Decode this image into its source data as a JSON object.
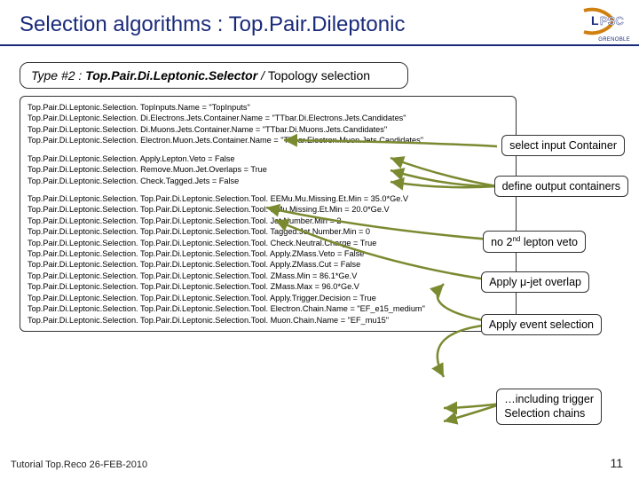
{
  "logo": {
    "text": "GRENOBLE",
    "title_big": "PSC",
    "title_l": "L"
  },
  "title": "Selection algorithms : Top.Pair.Dileptonic",
  "type_box": {
    "prefix": "Type #2 : ",
    "selector": "Top.Pair.Di.Leptonic.Selector",
    "slash": " / ",
    "suffix": "Topology selection"
  },
  "config": {
    "block1": [
      "Top.Pair.Di.Leptonic.Selection. TopInputs.Name                        = \"TopInputs\"",
      "Top.Pair.Di.Leptonic.Selection. Di.Electrons.Jets.Container.Name  = \"TTbar.Di.Electrons.Jets.Candidates\"",
      "Top.Pair.Di.Leptonic.Selection. Di.Muons.Jets.Container.Name                           = \"TTbar.Di.Muons.Jets.Candidates\"",
      "Top.Pair.Di.Leptonic.Selection. Electron.Muon.Jets.Container.Name = \"TTbar.Electron.Muon.Jets.Candidates\""
    ],
    "block2": [
      "Top.Pair.Di.Leptonic.Selection. Apply.Lepton.Veto        = False",
      "Top.Pair.Di.Leptonic.Selection. Remove.Muon.Jet.Overlaps = True",
      "Top.Pair.Di.Leptonic.Selection. Check.Tagged.Jets         = False"
    ],
    "block3": [
      "Top.Pair.Di.Leptonic.Selection. Top.Pair.Di.Leptonic.Selection.Tool. EEMu.Mu.Missing.Et.Min  = 35.0*Ge.V",
      "Top.Pair.Di.Leptonic.Selection. Top.Pair.Di.Leptonic.Selection.Tool. EMu.Missing.Et.Min    = 20.0*Ge.V",
      "Top.Pair.Di.Leptonic.Selection. Top.Pair.Di.Leptonic.Selection.Tool. Jet.Number.Min                = 2",
      "Top.Pair.Di.Leptonic.Selection. Top.Pair.Di.Leptonic.Selection.Tool. Tagged.Jet.Number.Min   = 0",
      "Top.Pair.Di.Leptonic.Selection. Top.Pair.Di.Leptonic.Selection.Tool. Check.Neutral.Charge      = True",
      "Top.Pair.Di.Leptonic.Selection. Top.Pair.Di.Leptonic.Selection.Tool. Apply.ZMass.Veto           = False",
      "Top.Pair.Di.Leptonic.Selection. Top.Pair.Di.Leptonic.Selection.Tool. Apply.ZMass.Cut             = False",
      "Top.Pair.Di.Leptonic.Selection. Top.Pair.Di.Leptonic.Selection.Tool. ZMass.Min                     = 86.1*Ge.V",
      "Top.Pair.Di.Leptonic.Selection. Top.Pair.Di.Leptonic.Selection.Tool. ZMass.Max                     = 96.0*Ge.V",
      "Top.Pair.Di.Leptonic.Selection. Top.Pair.Di.Leptonic.Selection.Tool. Apply.Trigger.Decision = True",
      "Top.Pair.Di.Leptonic.Selection. Top.Pair.Di.Leptonic.Selection.Tool. Electron.Chain.Name     = \"EF_e15_medium\"",
      "Top.Pair.Di.Leptonic.Selection. Top.Pair.Di.Leptonic.Selection.Tool. Muon.Chain.Name          = \"EF_mu15\""
    ]
  },
  "annotations": {
    "a1": "select input Container",
    "a2": "define output containers",
    "a3_left": "no 2",
    "a3_sup": "nd",
    "a3_right": " lepton veto",
    "a4_pre": "Apply ",
    "a4_mu": "μ",
    "a4_post": "-jet overlap",
    "a5": "Apply event selection",
    "a6_l1": "…including trigger",
    "a6_l2": "Selection chains"
  },
  "footer": {
    "left": "Tutorial Top.Reco 26-FEB-2010",
    "page": "11"
  }
}
